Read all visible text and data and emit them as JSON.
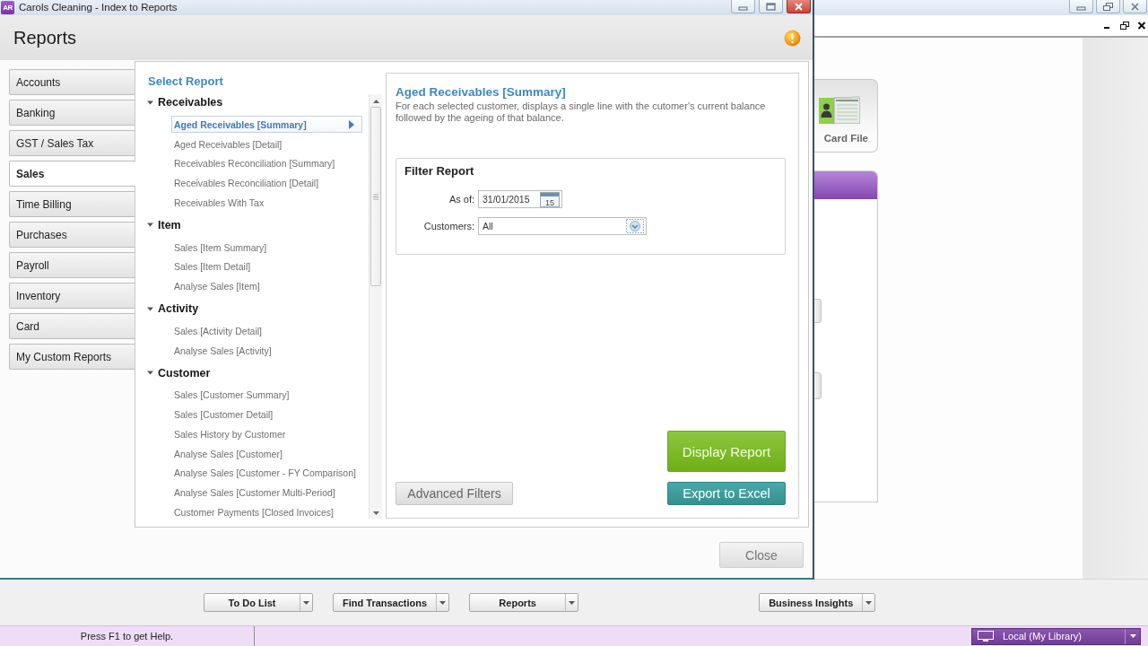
{
  "background_window": {
    "card_tile": {
      "label": "Card File"
    },
    "toolbar": [
      {
        "label": "To Do List"
      },
      {
        "label": "Find Transactions"
      },
      {
        "label": "Reports"
      },
      {
        "label": "Business Insights"
      }
    ],
    "status_bar": {
      "help_text": "Press F1 to get Help.",
      "location": "Local (My Library)"
    }
  },
  "dialog": {
    "app_icon": "AR",
    "title": "Carols Cleaning - Index to Reports",
    "heading": "Reports",
    "nav": [
      {
        "label": "Accounts",
        "selected": false
      },
      {
        "label": "Banking",
        "selected": false
      },
      {
        "label": "GST / Sales Tax",
        "selected": false
      },
      {
        "label": "Sales",
        "selected": true
      },
      {
        "label": "Time Billing",
        "selected": false
      },
      {
        "label": "Purchases",
        "selected": false
      },
      {
        "label": "Payroll",
        "selected": false
      },
      {
        "label": "Inventory",
        "selected": false
      },
      {
        "label": "Card",
        "selected": false
      },
      {
        "label": "My Custom Reports",
        "selected": false
      }
    ],
    "report_list": {
      "title": "Select Report",
      "groups": [
        {
          "label": "Receivables",
          "expanded": true,
          "children": [
            {
              "label": "Aged Receivables [Summary]",
              "selected": true
            },
            {
              "label": "Aged Receivables [Detail]",
              "selected": false
            },
            {
              "label": "Receivables Reconciliation [Summary]",
              "selected": false
            },
            {
              "label": "Receivables Reconciliation [Detail]",
              "selected": false
            },
            {
              "label": "Receivables With Tax",
              "selected": false
            }
          ]
        },
        {
          "label": "Item",
          "expanded": true,
          "children": [
            {
              "label": "Sales [Item Summary]",
              "selected": false
            },
            {
              "label": "Sales [Item Detail]",
              "selected": false
            },
            {
              "label": "Analyse Sales [Item]",
              "selected": false
            }
          ]
        },
        {
          "label": "Activity",
          "expanded": true,
          "children": [
            {
              "label": "Sales [Activity Detail]",
              "selected": false
            },
            {
              "label": "Analyse Sales [Activity]",
              "selected": false
            }
          ]
        },
        {
          "label": "Customer",
          "expanded": true,
          "children": [
            {
              "label": "Sales [Customer Summary]",
              "selected": false
            },
            {
              "label": "Sales [Customer Detail]",
              "selected": false
            },
            {
              "label": "Sales History by Customer",
              "selected": false
            },
            {
              "label": "Analyse Sales [Customer]",
              "selected": false
            },
            {
              "label": "Analyse Sales [Customer - FY Comparison]",
              "selected": false
            },
            {
              "label": "Analyse Sales [Customer Multi-Period]",
              "selected": false
            },
            {
              "label": "Customer Payments [Closed Invoices]",
              "selected": false
            }
          ]
        }
      ]
    },
    "detail": {
      "title": "Aged Receivables [Summary]",
      "description": "For each selected customer, displays a single line with the cutomer's current balance followed by the ageing of that balance.",
      "filter": {
        "title": "Filter Report",
        "fields": [
          {
            "kind": "date",
            "label": "As of:",
            "value": "31/01/2015",
            "calendar_day": "15"
          },
          {
            "kind": "dropdown",
            "label": "Customers:",
            "value": "All"
          }
        ]
      }
    },
    "buttons": [
      {
        "kind": "secondary",
        "label": "Advanced Filters"
      },
      {
        "kind": "primary",
        "label": "Display Report"
      },
      {
        "kind": "export",
        "label": "Export to Excel"
      }
    ],
    "close_button": "Close"
  }
}
